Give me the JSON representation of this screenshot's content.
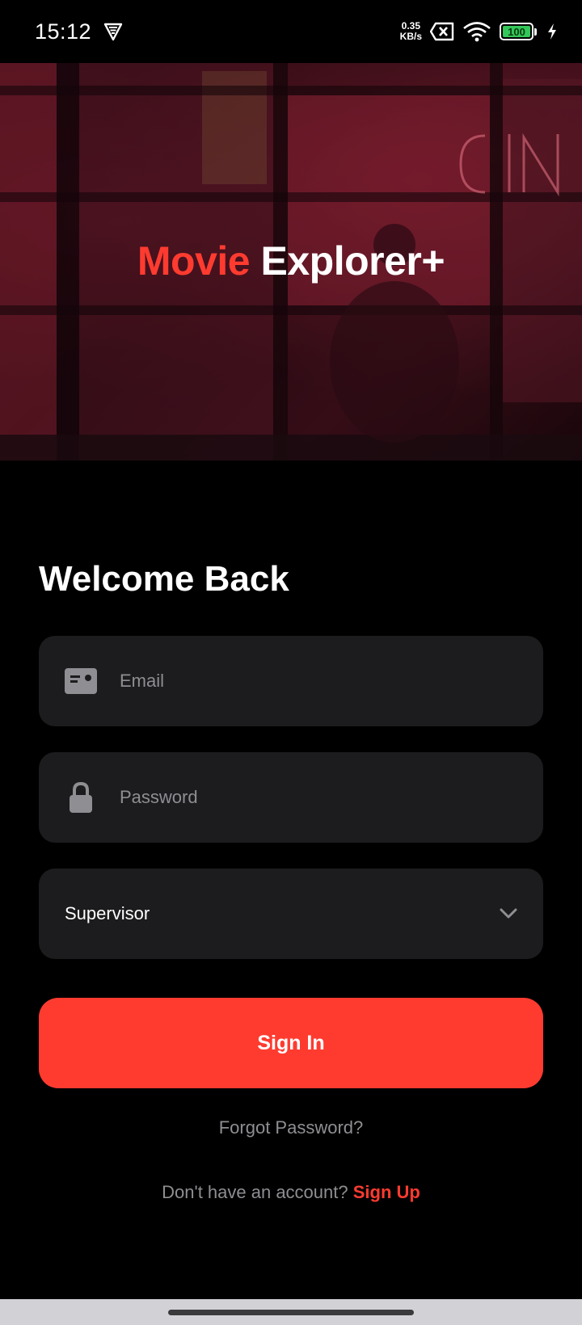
{
  "status_bar": {
    "time": "15:12",
    "net_speed_value": "0.35",
    "net_speed_unit": "KB/s",
    "battery_level": "100",
    "icons": [
      "vpn-icon",
      "sim-off-icon",
      "wifi-icon",
      "battery-icon",
      "charging-bolt-icon"
    ]
  },
  "hero": {
    "title_accent": "Movie",
    "title_rest": "Explorer+"
  },
  "form": {
    "heading": "Welcome Back",
    "email": {
      "placeholder": "Email",
      "value": "",
      "icon": "id-card-icon"
    },
    "password": {
      "placeholder": "Password",
      "value": "",
      "icon": "lock-icon"
    },
    "role": {
      "selected": "Supervisor",
      "icon": "chevron-down-icon"
    },
    "signin_label": "Sign In",
    "forgot_label": "Forgot Password?",
    "signup_prompt": "Don't have an account?",
    "signup_label": "Sign Up"
  },
  "colors": {
    "accent": "#ff3b30",
    "background": "#000000",
    "field_bg": "#1c1c1e",
    "muted_text": "#8e8e93"
  }
}
